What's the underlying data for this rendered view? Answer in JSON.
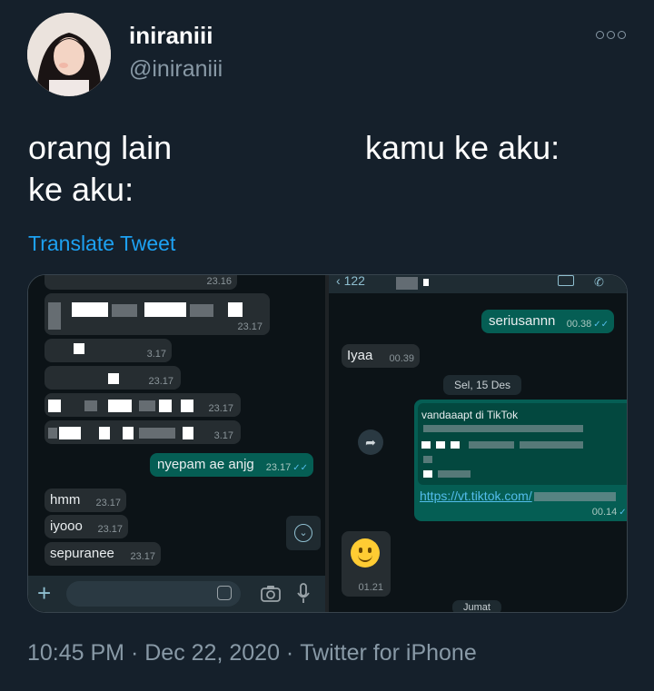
{
  "tweet": {
    "display_name": "iniraniii",
    "handle": "@iniraniii",
    "text_left_line1": "orang lain",
    "text_left_line2": "ke aku:",
    "text_right": "kamu ke aku:",
    "translate_label": "Translate Tweet",
    "time": "10:45 PM",
    "date": "Dec 22, 2020",
    "source": "Twitter for iPhone",
    "separator": "·"
  },
  "left_chat": {
    "top_time": "23.16",
    "redacted_messages": [
      {
        "time": "23.17"
      },
      {
        "time": "3.17"
      },
      {
        "time": "23.17"
      },
      {
        "time": "23.17"
      },
      {
        "time": "3.17"
      }
    ],
    "sent_message": {
      "text": "nyepam ae anjg",
      "time": "23.17"
    },
    "received_messages": [
      {
        "text": "hmm",
        "time": "23.17"
      },
      {
        "text": "iyooo",
        "time": "23.17"
      },
      {
        "text": "sepuranee",
        "time": "23.17"
      }
    ]
  },
  "right_chat": {
    "header_back": "122",
    "sent_top": {
      "text": "seriusannn",
      "time": "00.38"
    },
    "received_reply": {
      "text": "Iyaa",
      "time": "00.39"
    },
    "date_divider": "Sel, 15 Des",
    "shared_link": {
      "title": "vandaaapt di TikTok",
      "url": "https://vt.tiktok.com/",
      "time": "00.14"
    },
    "emoji": {
      "glyph": "🙂",
      "time": "01.21"
    },
    "bottom_pill": "Jumat"
  },
  "colors": {
    "background": "#15202b",
    "secondary_text": "#8899a6",
    "link": "#1da1f2",
    "outgoing_bubble": "#055e54",
    "incoming_bubble": "#262d31"
  }
}
